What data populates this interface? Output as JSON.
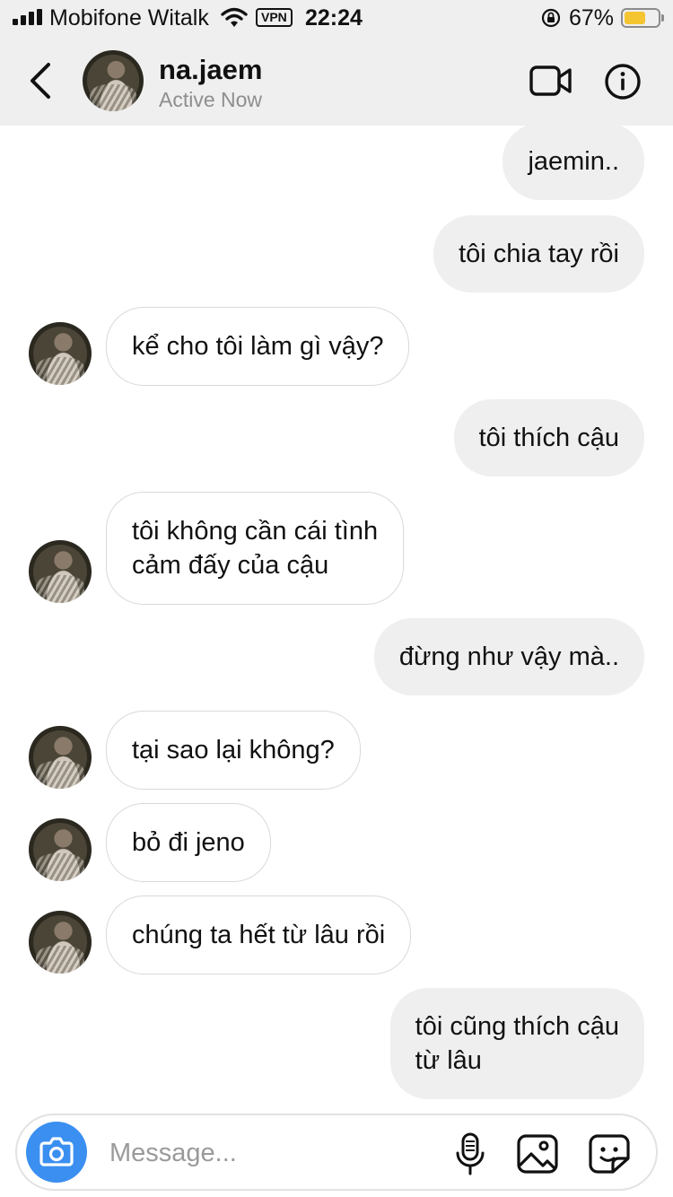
{
  "status_bar": {
    "carrier": "Mobifone Witalk",
    "vpn": "VPN",
    "time": "22:24",
    "battery": "67%",
    "battery_color": "#f5c431"
  },
  "header": {
    "back_icon": "chevron-left-icon",
    "name": "na.jaem",
    "status": "Active Now",
    "video_icon": "video-camera-icon",
    "info_icon": "info-icon"
  },
  "messages": [
    {
      "from": "me",
      "text": "jaemin.."
    },
    {
      "from": "me",
      "text": "tôi chia tay rồi"
    },
    {
      "from": "them",
      "text": "kể cho tôi làm gì vậy?"
    },
    {
      "from": "me",
      "text": "tôi thích cậu"
    },
    {
      "from": "them",
      "lines": [
        "tôi không cần cái tình",
        "cảm đấy của cậu"
      ]
    },
    {
      "from": "me",
      "text": "đừng như vậy mà.."
    },
    {
      "from": "them",
      "text": "tại sao lại không?"
    },
    {
      "from": "them",
      "text": "bỏ đi jeno"
    },
    {
      "from": "them",
      "text": "chúng ta hết từ lâu rồi"
    },
    {
      "from": "me",
      "lines": [
        "tôi cũng thích cậu",
        "từ lâu"
      ]
    }
  ],
  "composer": {
    "placeholder": "Message...",
    "camera_icon": "camera-icon",
    "mic_icon": "microphone-icon",
    "gallery_icon": "image-icon",
    "sticker_icon": "sticker-icon",
    "accent": "#3a8ff0"
  },
  "colors": {
    "header_bg": "#efefef",
    "sent_bubble": "#efefef",
    "received_border": "#d9d9d9",
    "secondary_text": "#8e8e8e"
  }
}
